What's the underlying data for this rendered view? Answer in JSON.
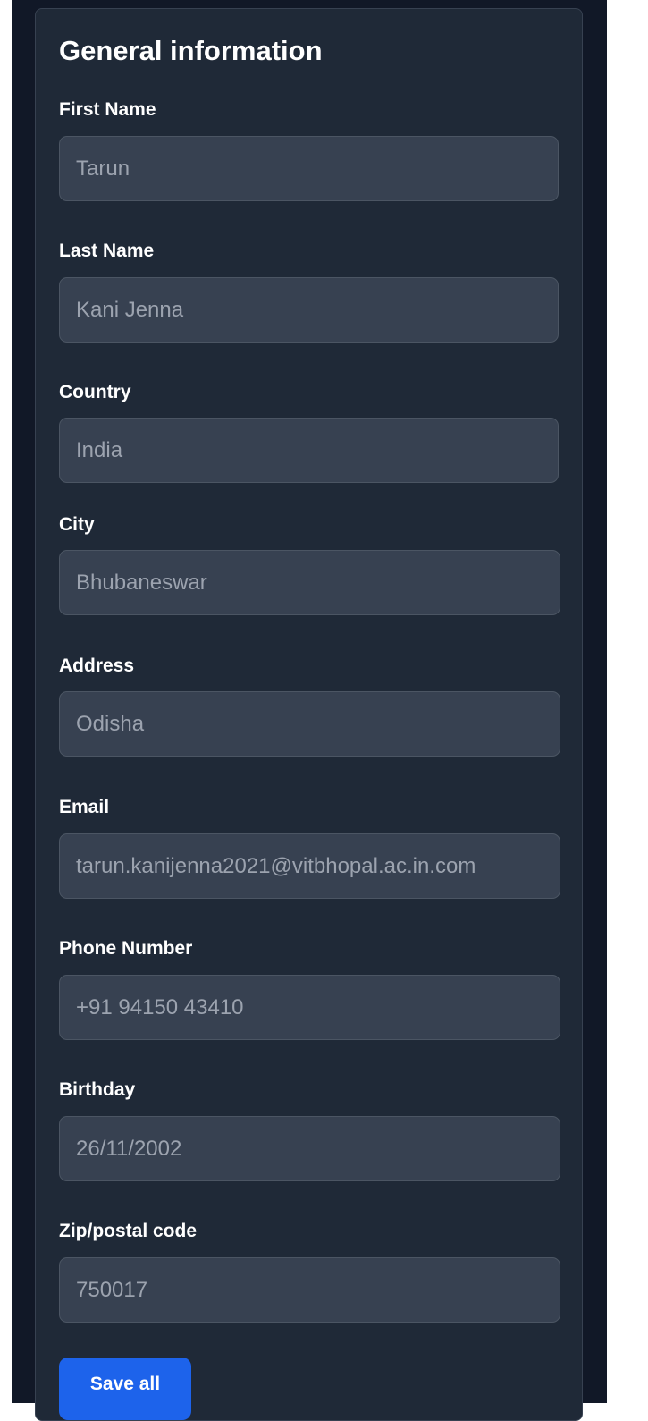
{
  "form": {
    "title": "General information",
    "fields": [
      {
        "label": "First Name",
        "placeholder": "Tarun"
      },
      {
        "label": "Last Name",
        "placeholder": "Kani Jenna"
      },
      {
        "label": "Country",
        "placeholder": "India"
      },
      {
        "label": "City",
        "placeholder": "Bhubaneswar"
      },
      {
        "label": "Address",
        "placeholder": "Odisha"
      },
      {
        "label": "Email",
        "placeholder": "tarun.kanijenna2021@vitbhopal.ac.in.com"
      },
      {
        "label": "Phone Number",
        "placeholder": "+91 94150 43410"
      },
      {
        "label": "Birthday",
        "placeholder": "26/11/2002"
      },
      {
        "label": "Zip/postal code",
        "placeholder": "750017"
      }
    ],
    "save_label": "Save all"
  },
  "colors": {
    "page_background": "#111827",
    "card_background": "#1f2937",
    "input_background": "#374151",
    "placeholder_text": "#9ca3af",
    "accent": "#1d63eb"
  }
}
